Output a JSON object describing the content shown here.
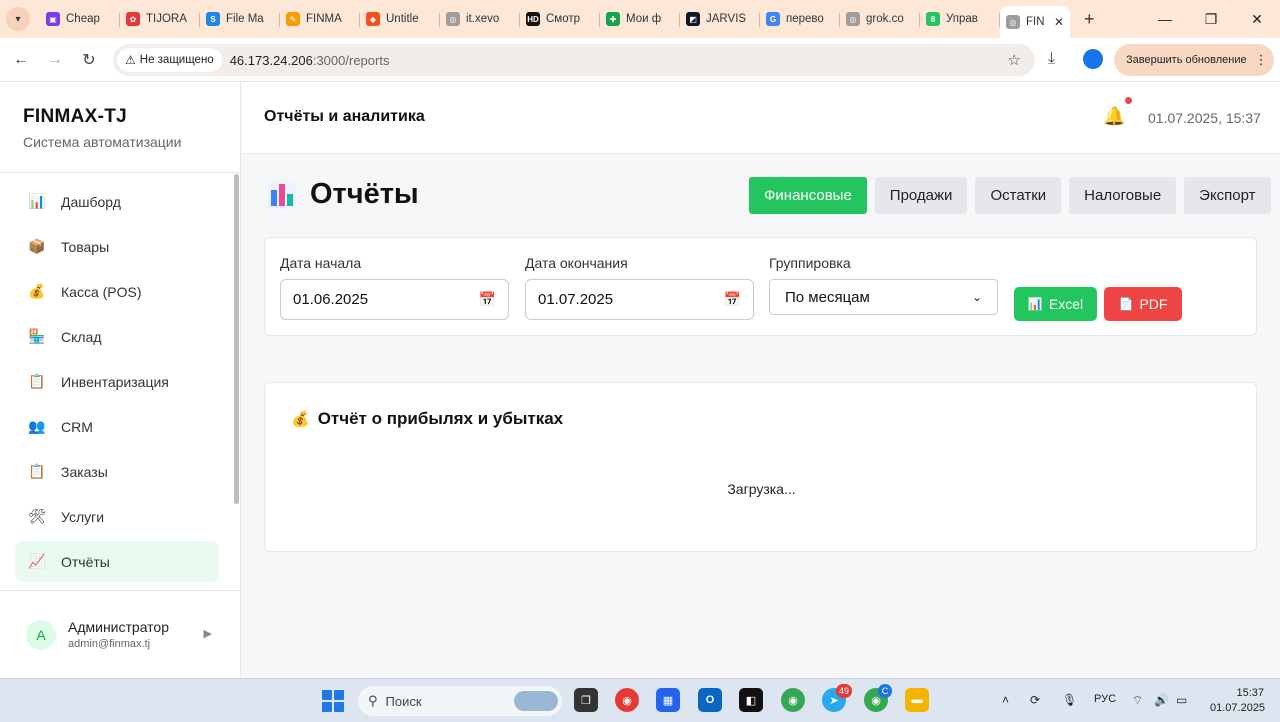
{
  "browser": {
    "tabs": [
      {
        "label": "Cheap",
        "color": "#7c3aed",
        "glyph": "▣"
      },
      {
        "label": "TIJORA",
        "color": "#e53935",
        "glyph": "✿"
      },
      {
        "label": "File Ma",
        "color": "#1e88e5",
        "glyph": "S"
      },
      {
        "label": "FINMA",
        "color": "#f59e0b",
        "glyph": "✎"
      },
      {
        "label": "Untitle",
        "color": "#f24e1e",
        "glyph": "◆"
      },
      {
        "label": "it.xevo",
        "color": "#9e9e9e",
        "glyph": "◎"
      },
      {
        "label": "Смотр",
        "color": "#111111",
        "glyph": "HD"
      },
      {
        "label": "Мои ф",
        "color": "#16a34a",
        "glyph": "✚"
      },
      {
        "label": "JARVIS",
        "color": "#0f172a",
        "glyph": "◩"
      },
      {
        "label": "перево",
        "color": "#4285f4",
        "glyph": "G"
      },
      {
        "label": "grok.co",
        "color": "#9e9e9e",
        "glyph": "◎"
      },
      {
        "label": "Управ",
        "color": "#22c55e",
        "glyph": "8"
      }
    ],
    "active_tab": {
      "label": "FIN",
      "color": "#9e9e9e",
      "glyph": "◎"
    },
    "insecure_label": "Не защищено",
    "url_host": "46.173.24.206",
    "url_path": ":3000/reports",
    "update_label": "Завершить обновление"
  },
  "sidebar": {
    "brand_title": "FINMAX-TJ",
    "brand_subtitle": "Система автоматизации",
    "items": [
      {
        "label": "Дашборд",
        "icon": "chart-icon",
        "glyph": "📊"
      },
      {
        "label": "Товары",
        "icon": "box-icon",
        "glyph": "📦"
      },
      {
        "label": "Касса (POS)",
        "icon": "money-bag-icon",
        "glyph": "💰"
      },
      {
        "label": "Склад",
        "icon": "warehouse-icon",
        "glyph": "🏪"
      },
      {
        "label": "Инвентаризация",
        "icon": "clipboard-icon",
        "glyph": "📋"
      },
      {
        "label": "CRM",
        "icon": "users-icon",
        "glyph": "👥"
      },
      {
        "label": "Заказы",
        "icon": "clipboard-icon",
        "glyph": "📋"
      },
      {
        "label": "Услуги",
        "icon": "tools-icon",
        "glyph": "🛠"
      },
      {
        "label": "Отчёты",
        "icon": "trend-icon",
        "glyph": "📈"
      }
    ],
    "active_item": "Отчёты",
    "user": {
      "initial": "A",
      "name": "Администратор",
      "email": "admin@finmax.tj"
    }
  },
  "topbar": {
    "title": "Отчёты и аналитика",
    "datetime": "01.07.2025, 15:37"
  },
  "page": {
    "title": "Отчёты",
    "tabs": [
      "Финансовые",
      "Продажи",
      "Остатки",
      "Налоговые",
      "Экспорт"
    ],
    "active_tab": "Финансовые"
  },
  "filters": {
    "start_label": "Дата начала",
    "start_value": "01.06.2025",
    "end_label": "Дата окончания",
    "end_value": "01.07.2025",
    "group_label": "Группировка",
    "group_value": "По месяцам",
    "excel_label": "Excel",
    "pdf_label": "PDF"
  },
  "report": {
    "title": "Отчёт о прибылях и убытках",
    "loading": "Загрузка..."
  },
  "taskbar": {
    "search_placeholder": "Поиск",
    "lang": "РУС",
    "time": "15:37",
    "date": "01.07.2025",
    "telegram_badge": "49",
    "chrome_badge": "C"
  },
  "colors": {
    "accent_green": "#22c55e",
    "pdf_red": "#ef4444",
    "sidebar_active_bg": "#e9faf0"
  }
}
